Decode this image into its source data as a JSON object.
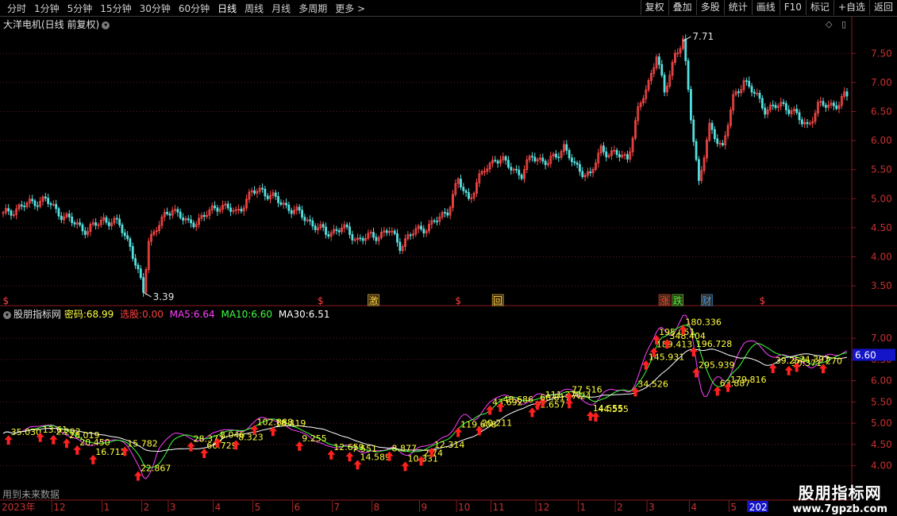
{
  "toolbar": {
    "periods": [
      "分时",
      "1分钟",
      "5分钟",
      "15分钟",
      "30分钟",
      "60分钟",
      "日线",
      "周线",
      "月线",
      "多周期",
      "更多 >"
    ],
    "active": "日线",
    "actions": [
      "复权",
      "叠加",
      "多股",
      "统计",
      "画线",
      "F10",
      "标记",
      "+自选",
      "返回"
    ]
  },
  "header": {
    "title": "大洋电机(日线 前复权)",
    "icon": "chevron-down-icon"
  },
  "indicator": {
    "name": "股朋指标网",
    "mima_label": "密码:",
    "mima_value": "68.99",
    "xuangu_label": "选股:",
    "xuangu_value": "0.00",
    "ma5_label": "MA5:",
    "ma5_value": "6.64",
    "ma10_label": "MA10:",
    "ma10_value": "6.60",
    "ma30_label": "MA30:",
    "ma30_value": "6.51",
    "current_tag": "6.60"
  },
  "footer": {
    "no_future_text": "用到未来数据",
    "watermark_line1": "股朋指标网",
    "watermark_line2": "www.7gpzb.com"
  },
  "colors": {
    "up": "#ff4a4a",
    "down": "#55e0e0",
    "ma5": "#ff40ff",
    "ma10": "#40ff40",
    "ma30": "#ffffff",
    "label": "#ffff40",
    "arrow": "#ff2020"
  },
  "chart_data": {
    "type": "candlestick",
    "price_axis": {
      "ticks": [
        "3.50",
        "4.00",
        "4.50",
        "5.00",
        "5.50",
        "6.00",
        "6.50",
        "7.00",
        "7.50"
      ],
      "ylim": [
        3.2,
        7.9
      ]
    },
    "indicator_axis": {
      "ticks": [
        "4.00",
        "4.50",
        "5.00",
        "5.50",
        "6.00",
        "6.50",
        "7.00"
      ],
      "ylim": [
        3.75,
        7.45
      ]
    },
    "x_axis": [
      {
        "label": "2023年",
        "idx": 0
      },
      {
        "label": "12",
        "idx": 19
      },
      {
        "label": "1",
        "idx": 38
      },
      {
        "label": "2",
        "idx": 53
      },
      {
        "label": "3",
        "idx": 63
      },
      {
        "label": "4",
        "idx": 80
      },
      {
        "label": "5",
        "idx": 95
      },
      {
        "label": "6",
        "idx": 110
      },
      {
        "label": "7",
        "idx": 125
      },
      {
        "label": "8",
        "idx": 140
      },
      {
        "label": "9",
        "idx": 158
      },
      {
        "label": "10",
        "idx": 172
      },
      {
        "label": "11",
        "idx": 185
      },
      {
        "label": "12",
        "idx": 202
      },
      {
        "label": "1",
        "idx": 218
      },
      {
        "label": "2",
        "idx": 232
      },
      {
        "label": "3",
        "idx": 244
      },
      {
        "label": "4",
        "idx": 260
      },
      {
        "label": "5",
        "idx": 275
      },
      {
        "label": "202",
        "idx": 282
      }
    ],
    "anchors": [
      [
        0,
        4.72
      ],
      [
        6,
        4.85
      ],
      [
        12,
        4.95
      ],
      [
        16,
        4.98
      ],
      [
        20,
        4.8
      ],
      [
        26,
        4.6
      ],
      [
        32,
        4.45
      ],
      [
        38,
        4.65
      ],
      [
        44,
        4.55
      ],
      [
        48,
        4.2
      ],
      [
        53,
        3.39
      ],
      [
        55,
        4.3
      ],
      [
        58,
        4.5
      ],
      [
        64,
        4.85
      ],
      [
        70,
        4.55
      ],
      [
        76,
        4.7
      ],
      [
        82,
        4.9
      ],
      [
        88,
        4.75
      ],
      [
        94,
        5.1
      ],
      [
        98,
        5.15
      ],
      [
        104,
        4.95
      ],
      [
        110,
        4.8
      ],
      [
        116,
        4.6
      ],
      [
        122,
        4.4
      ],
      [
        128,
        4.5
      ],
      [
        134,
        4.3
      ],
      [
        140,
        4.35
      ],
      [
        146,
        4.45
      ],
      [
        150,
        4.2
      ],
      [
        156,
        4.45
      ],
      [
        162,
        4.55
      ],
      [
        168,
        4.8
      ],
      [
        172,
        5.3
      ],
      [
        176,
        5.0
      ],
      [
        182,
        5.5
      ],
      [
        186,
        5.7
      ],
      [
        192,
        5.55
      ],
      [
        196,
        5.4
      ],
      [
        200,
        5.75
      ],
      [
        206,
        5.6
      ],
      [
        212,
        5.9
      ],
      [
        216,
        5.55
      ],
      [
        222,
        5.4
      ],
      [
        226,
        5.85
      ],
      [
        232,
        5.75
      ],
      [
        236,
        5.7
      ],
      [
        240,
        6.5
      ],
      [
        244,
        7.0
      ],
      [
        247,
        7.5
      ],
      [
        250,
        6.8
      ],
      [
        254,
        7.5
      ],
      [
        257,
        7.71
      ],
      [
        260,
        6.4
      ],
      [
        263,
        5.3
      ],
      [
        267,
        6.2
      ],
      [
        272,
        5.9
      ],
      [
        276,
        6.7
      ],
      [
        280,
        7.05
      ],
      [
        284,
        6.8
      ],
      [
        288,
        6.55
      ],
      [
        294,
        6.6
      ],
      [
        298,
        6.55
      ],
      [
        302,
        6.3
      ],
      [
        304,
        6.25
      ],
      [
        308,
        6.6
      ],
      [
        312,
        6.6
      ],
      [
        316,
        6.65
      ],
      [
        318,
        6.75
      ]
    ],
    "extremes": {
      "low": {
        "value": "3.39",
        "idx": 53
      },
      "high": {
        "value": "7.71",
        "idx": 257
      }
    },
    "event_markers": [
      {
        "label": "$",
        "idx": 1,
        "color": "#ff4040"
      },
      {
        "label": "$",
        "idx": 120,
        "color": "#ff4040"
      },
      {
        "label": "激",
        "idx": 140,
        "color": "#ffd040",
        "box": true
      },
      {
        "label": "$",
        "idx": 172,
        "color": "#ff4040"
      },
      {
        "label": "回",
        "idx": 187,
        "color": "#ffd040",
        "box": true
      },
      {
        "label": "涨",
        "idx": 250,
        "color": "#ff4040",
        "box": true
      },
      {
        "label": "跌",
        "idx": 255,
        "color": "#40ff40",
        "box": true
      },
      {
        "label": "财",
        "idx": 266,
        "color": "#40a0ff",
        "box": true
      },
      {
        "label": "$",
        "idx": 287,
        "color": "#ff4040"
      }
    ],
    "signal_labels": [
      {
        "text": "35.030",
        "idx": 2
      },
      {
        "text": "13.61",
        "idx": 14
      },
      {
        "text": "2.292",
        "idx": 19
      },
      {
        "text": "28.019",
        "idx": 24
      },
      {
        "text": "20.450",
        "idx": 28
      },
      {
        "text": "16.712",
        "idx": 34
      },
      {
        "text": "15.782",
        "idx": 46
      },
      {
        "text": "22.867",
        "idx": 51
      },
      {
        "text": "66.729",
        "idx": 76
      },
      {
        "text": "28.377",
        "idx": 71
      },
      {
        "text": "8.046",
        "idx": 81
      },
      {
        "text": "8.323",
        "idx": 88
      },
      {
        "text": "102.888",
        "idx": 95
      },
      {
        "text": "18.419",
        "idx": 102
      },
      {
        "text": "9.255",
        "idx": 112
      },
      {
        "text": "12.659",
        "idx": 124
      },
      {
        "text": "7.551",
        "idx": 131
      },
      {
        "text": "14.589",
        "idx": 134
      },
      {
        "text": "8.877",
        "idx": 146
      },
      {
        "text": "10.331",
        "idx": 152
      },
      {
        "text": "2.74",
        "idx": 158
      },
      {
        "text": "12.314",
        "idx": 162
      },
      {
        "text": "119.608",
        "idx": 172
      },
      {
        "text": "20.211",
        "idx": 180
      },
      {
        "text": "43.692",
        "idx": 184
      },
      {
        "text": "48.686",
        "idx": 188
      },
      {
        "text": "32.657",
        "idx": 200
      },
      {
        "text": "111.378",
        "idx": 204
      },
      {
        "text": "60.817",
        "idx": 202
      },
      {
        "text": "7.24",
        "idx": 214
      },
      {
        "text": "77.516",
        "idx": 214
      },
      {
        "text": "14.555",
        "idx": 222
      },
      {
        "text": "44.555",
        "idx": 224
      },
      {
        "text": "34.526",
        "idx": 239
      },
      {
        "text": "145.931",
        "idx": 243
      },
      {
        "text": "189.413",
        "idx": 246
      },
      {
        "text": "195.051",
        "idx": 247
      },
      {
        "text": "348.404",
        "idx": 251
      },
      {
        "text": "180.336",
        "idx": 257
      },
      {
        "text": "196.728",
        "idx": 261
      },
      {
        "text": "295.939",
        "idx": 262
      },
      {
        "text": "63.887",
        "idx": 270
      },
      {
        "text": "179.816",
        "idx": 274
      },
      {
        "text": "39.254",
        "idx": 291
      },
      {
        "text": "30.371",
        "idx": 297
      },
      {
        "text": "74.397",
        "idx": 300
      },
      {
        "text": "270",
        "idx": 310
      }
    ]
  }
}
